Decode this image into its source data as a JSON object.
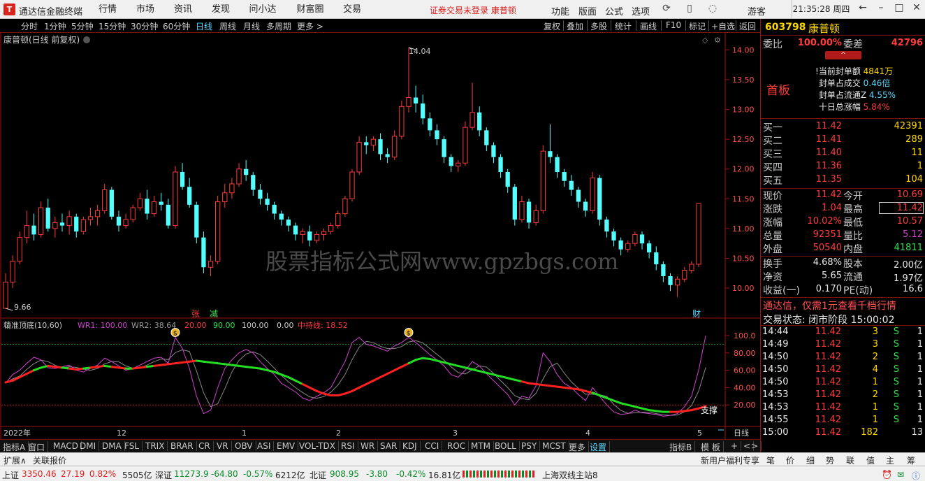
{
  "titlebar": {
    "app_name": "通达信金融终端",
    "menus": [
      "行情",
      "市场",
      "资讯",
      "发现",
      "问小达",
      "财富圈",
      "交易"
    ],
    "warning": "证券交易未登录  康普顿",
    "right_menus": [
      "功能",
      "版面",
      "公式",
      "选项"
    ],
    "guest": "游客",
    "clock": "21:35:28 周四"
  },
  "periodbar": {
    "periods": [
      "分时",
      "1分钟",
      "5分钟",
      "15分钟",
      "30分钟",
      "60分钟",
      "日线",
      "周线",
      "月线",
      "多周期",
      "更多 >"
    ],
    "tools": [
      "复权",
      "叠加",
      "多股",
      "统计",
      "画线",
      "F10",
      "标记",
      "+自选",
      "返回"
    ]
  },
  "chart": {
    "label": "康普顿(日线 前复权)",
    "watermark": "股票指标公式网www.gpzbgs.com",
    "high_marker": "14.04",
    "low_marker": "9.66",
    "price_ticks": [
      "14.00",
      "13.50",
      "13.00",
      "12.50",
      "12.00",
      "11.50",
      "11.00",
      "10.50",
      "10.00"
    ],
    "event_zhang": "张",
    "event_jian": "减",
    "event_cai": "财",
    "indicator": {
      "name": "精准顶底(10,60)",
      "wr1_label": "WR1: 100.00",
      "wr2_label": "WR2: 38.64",
      "v20": "20.00",
      "v90": "90.00",
      "v100": "100.00",
      "v0": "0.00",
      "mid_label": "中持线: 18.52",
      "ticks": [
        "100.0",
        "80.00",
        "60.00",
        "40.00",
        "20.00"
      ],
      "support_label": "支撑"
    },
    "xaxis": [
      "2022年",
      "12",
      "1",
      "2",
      "3",
      "4",
      "5"
    ],
    "right_label": "日线"
  },
  "chart_data": {
    "type": "candlestick",
    "ylim": [
      9.66,
      14.04
    ],
    "candles": [
      [
        9.66,
        10.25,
        9.66,
        10.1
      ],
      [
        10.1,
        10.55,
        10.0,
        10.45
      ],
      [
        10.45,
        10.95,
        10.4,
        10.85
      ],
      [
        10.85,
        11.3,
        10.75,
        11.05
      ],
      [
        11.05,
        11.25,
        10.8,
        10.9
      ],
      [
        10.9,
        11.45,
        10.85,
        11.35
      ],
      [
        11.35,
        11.5,
        10.95,
        11.0
      ],
      [
        11.0,
        11.2,
        10.85,
        11.1
      ],
      [
        11.1,
        11.25,
        10.95,
        11.05
      ],
      [
        11.05,
        11.3,
        10.9,
        11.2
      ],
      [
        11.2,
        11.25,
        10.85,
        10.95
      ],
      [
        10.95,
        11.2,
        10.9,
        11.15
      ],
      [
        11.15,
        11.35,
        11.05,
        11.2
      ],
      [
        11.2,
        11.4,
        11.05,
        11.3
      ],
      [
        11.3,
        11.75,
        11.25,
        11.65
      ],
      [
        11.65,
        11.7,
        11.15,
        11.2
      ],
      [
        11.2,
        11.3,
        10.95,
        11.05
      ],
      [
        11.05,
        11.25,
        11.0,
        11.15
      ],
      [
        11.15,
        11.4,
        11.1,
        11.35
      ],
      [
        11.35,
        11.6,
        11.3,
        11.5
      ],
      [
        11.5,
        11.65,
        11.15,
        11.25
      ],
      [
        11.25,
        11.55,
        11.2,
        11.45
      ],
      [
        11.45,
        11.6,
        11.3,
        11.4
      ],
      [
        11.4,
        11.5,
        11.0,
        11.05
      ],
      [
        11.05,
        12.05,
        11.0,
        11.95
      ],
      [
        11.95,
        12.1,
        11.65,
        11.7
      ],
      [
        11.7,
        11.85,
        11.35,
        11.4
      ],
      [
        11.4,
        11.45,
        10.75,
        10.85
      ],
      [
        10.85,
        10.95,
        10.25,
        10.35
      ],
      [
        10.35,
        10.55,
        10.2,
        10.45
      ],
      [
        10.45,
        11.55,
        10.4,
        11.45
      ],
      [
        11.45,
        11.75,
        11.35,
        11.6
      ],
      [
        11.6,
        11.85,
        11.5,
        11.75
      ],
      [
        11.75,
        12.1,
        11.7,
        12.0
      ],
      [
        12.0,
        12.15,
        11.8,
        11.9
      ],
      [
        11.9,
        11.95,
        11.55,
        11.65
      ],
      [
        11.65,
        11.75,
        11.4,
        11.5
      ],
      [
        11.5,
        11.6,
        11.3,
        11.4
      ],
      [
        11.4,
        11.45,
        11.15,
        11.25
      ],
      [
        11.25,
        11.3,
        11.05,
        11.15
      ],
      [
        11.15,
        11.2,
        10.95,
        11.05
      ],
      [
        11.05,
        11.1,
        10.8,
        10.9
      ],
      [
        10.9,
        11.0,
        10.75,
        10.95
      ],
      [
        10.95,
        11.05,
        10.7,
        10.8
      ],
      [
        10.8,
        10.95,
        10.75,
        10.9
      ],
      [
        10.9,
        11.0,
        10.8,
        10.95
      ],
      [
        10.95,
        11.1,
        10.9,
        11.05
      ],
      [
        11.05,
        11.3,
        11.0,
        11.25
      ],
      [
        11.25,
        11.55,
        11.2,
        11.5
      ],
      [
        11.5,
        12.0,
        11.45,
        11.95
      ],
      [
        11.95,
        12.55,
        11.9,
        12.45
      ],
      [
        12.45,
        12.55,
        12.25,
        12.4
      ],
      [
        12.4,
        12.55,
        12.3,
        12.5
      ],
      [
        12.5,
        12.6,
        12.15,
        12.25
      ],
      [
        12.25,
        12.35,
        12.1,
        12.2
      ],
      [
        12.2,
        12.65,
        12.15,
        12.55
      ],
      [
        12.55,
        13.15,
        12.5,
        13.05
      ],
      [
        13.05,
        14.04,
        12.95,
        13.2
      ],
      [
        13.2,
        13.4,
        12.95,
        13.1
      ],
      [
        13.1,
        13.25,
        12.75,
        12.85
      ],
      [
        12.85,
        12.95,
        12.55,
        12.65
      ],
      [
        12.65,
        12.75,
        12.4,
        12.5
      ],
      [
        12.5,
        12.55,
        12.1,
        12.2
      ],
      [
        12.2,
        12.25,
        11.95,
        12.05
      ],
      [
        12.05,
        12.15,
        11.95,
        12.1
      ],
      [
        12.1,
        12.8,
        12.05,
        12.7
      ],
      [
        12.7,
        13.45,
        12.65,
        12.95
      ],
      [
        12.95,
        13.05,
        12.55,
        12.65
      ],
      [
        12.65,
        12.7,
        12.3,
        12.4
      ],
      [
        12.4,
        12.45,
        12.1,
        12.2
      ],
      [
        12.2,
        12.25,
        11.85,
        11.95
      ],
      [
        11.95,
        12.0,
        11.6,
        11.7
      ],
      [
        11.7,
        11.75,
        11.05,
        11.15
      ],
      [
        11.15,
        11.55,
        11.1,
        11.45
      ],
      [
        11.45,
        11.5,
        11.0,
        11.1
      ],
      [
        11.1,
        11.4,
        11.05,
        11.3
      ],
      [
        11.3,
        12.4,
        11.25,
        12.3
      ],
      [
        12.3,
        12.75,
        12.1,
        12.2
      ],
      [
        12.2,
        12.25,
        11.85,
        11.95
      ],
      [
        11.95,
        12.0,
        11.7,
        11.8
      ],
      [
        11.8,
        11.9,
        11.55,
        11.65
      ],
      [
        11.65,
        11.7,
        11.35,
        11.45
      ],
      [
        11.45,
        11.5,
        11.2,
        11.3
      ],
      [
        11.3,
        11.95,
        11.25,
        11.85
      ],
      [
        11.85,
        11.9,
        11.05,
        11.15
      ],
      [
        11.15,
        11.2,
        10.85,
        10.95
      ],
      [
        10.95,
        11.0,
        10.7,
        10.8
      ],
      [
        10.8,
        10.85,
        10.55,
        10.65
      ],
      [
        10.65,
        10.8,
        10.6,
        10.75
      ],
      [
        10.75,
        10.95,
        10.7,
        10.9
      ],
      [
        10.9,
        10.95,
        10.65,
        10.75
      ],
      [
        10.75,
        10.8,
        10.5,
        10.6
      ],
      [
        10.6,
        10.7,
        10.3,
        10.4
      ],
      [
        10.4,
        10.45,
        10.1,
        10.2
      ],
      [
        10.2,
        10.25,
        9.95,
        10.05
      ],
      [
        10.05,
        10.2,
        9.85,
        10.15
      ],
      [
        10.15,
        10.35,
        10.1,
        10.3
      ],
      [
        10.3,
        10.45,
        10.25,
        10.4
      ],
      [
        10.4,
        11.42,
        10.35,
        11.42
      ]
    ],
    "wr": [
      45,
      55,
      60,
      68,
      75,
      72,
      63,
      62,
      64,
      66,
      60,
      58,
      62,
      66,
      74,
      70,
      65,
      60,
      62,
      66,
      70,
      74,
      75,
      68,
      98,
      85,
      62,
      30,
      10,
      14,
      40,
      62,
      72,
      80,
      84,
      80,
      70,
      62,
      55,
      45,
      40,
      35,
      28,
      25,
      30,
      34,
      40,
      55,
      70,
      92,
      98,
      90,
      88,
      85,
      82,
      88,
      92,
      98,
      92,
      85,
      78,
      72,
      65,
      55,
      52,
      60,
      70,
      65,
      56,
      48,
      40,
      32,
      20,
      30,
      28,
      42,
      80,
      70,
      55,
      45,
      40,
      32,
      25,
      40,
      30,
      20,
      12,
      9,
      10,
      14,
      11,
      10,
      9,
      7,
      8,
      10,
      18,
      30,
      60,
      100
    ],
    "mid": [
      46,
      48,
      52,
      56,
      60,
      63,
      65,
      64,
      63,
      62,
      61,
      62,
      63,
      64,
      65,
      64,
      63,
      62,
      62,
      63,
      64,
      65,
      66,
      67,
      68,
      69,
      70,
      71,
      70,
      69,
      68,
      67,
      66,
      65,
      64,
      63,
      62,
      60,
      58,
      55,
      52,
      48,
      44,
      40,
      36,
      33,
      31,
      31,
      33,
      36,
      40,
      44,
      48,
      52,
      56,
      60,
      64,
      68,
      72,
      74,
      73,
      71,
      69,
      67,
      65,
      63,
      61,
      59,
      57,
      55,
      53,
      51,
      49,
      47,
      45,
      44,
      43,
      42,
      41,
      40,
      39,
      38,
      36,
      34,
      31,
      28,
      25,
      22,
      20,
      18,
      16,
      14,
      13,
      12,
      12,
      12,
      13,
      14,
      16,
      18.52
    ],
    "mid_red": [
      1,
      1,
      1,
      1,
      1,
      0,
      0,
      1,
      1,
      0,
      1,
      1,
      0,
      1,
      1,
      0,
      1,
      1,
      0,
      1,
      1,
      0,
      1,
      1,
      1,
      1,
      1,
      1,
      0,
      0,
      0,
      0,
      0,
      0,
      0,
      0,
      0,
      0,
      0,
      0,
      0,
      0,
      0,
      1,
      1,
      1,
      1,
      1,
      1,
      1,
      1,
      1,
      1,
      1,
      1,
      1,
      1,
      1,
      0,
      0,
      0,
      0,
      0,
      0,
      0,
      0,
      0,
      0,
      0,
      0,
      0,
      0,
      0,
      0,
      1,
      1,
      1,
      1,
      1,
      1,
      1,
      1,
      1,
      1,
      0,
      0,
      0,
      0,
      0,
      0,
      0,
      0,
      0,
      0,
      0,
      1,
      1,
      1,
      1,
      1
    ]
  },
  "quote": {
    "code": "603798",
    "name": "康普顿",
    "weibi_label": "委比",
    "weibi_value": "100.00%",
    "weicha_label": "委差",
    "weicha_value": "42796",
    "board_label": "首板",
    "seal_rows": [
      {
        "label": "当前封单额",
        "value": "4841万"
      },
      {
        "label": "封单占成交",
        "value": "0.46倍"
      },
      {
        "label": "封单占流通Z",
        "value": "4.55%"
      },
      {
        "label": "十日总涨幅",
        "value": "5.84%"
      }
    ],
    "bids": [
      {
        "label": "买一",
        "price": "11.42",
        "vol": "42391"
      },
      {
        "label": "买二",
        "price": "11.41",
        "vol": "289"
      },
      {
        "label": "买三",
        "price": "11.40",
        "vol": "11"
      },
      {
        "label": "买四",
        "price": "11.36",
        "vol": "1"
      },
      {
        "label": "买五",
        "price": "11.35",
        "vol": "104"
      }
    ],
    "stats": [
      {
        "l1": "现价",
        "v1": "11.42",
        "l2": "今开",
        "v2": "10.69"
      },
      {
        "l1": "涨跌",
        "v1": "1.04",
        "l2": "最高",
        "v2": "11.42"
      },
      {
        "l1": "涨幅",
        "v1": "10.02%",
        "l2": "最低",
        "v2": "10.57"
      },
      {
        "l1": "总量",
        "v1": "92351",
        "l2": "量比",
        "v2": "5.12"
      },
      {
        "l1": "外盘",
        "v1": "50540",
        "l2": "内盘",
        "v2": "41811"
      }
    ],
    "stats2": [
      {
        "l1": "换手",
        "v1": "4.68%",
        "l2": "股本",
        "v2": "2.00亿"
      },
      {
        "l1": "净资",
        "v1": "5.65",
        "l2": "流通",
        "v2": "1.97亿"
      },
      {
        "l1": "收益(一)",
        "v1": "0.170",
        "l2": "PE(动)",
        "v2": "16.6"
      }
    ],
    "ad": "通达信，仅需1元查看千档行情",
    "trade_status": "交易状态: 闭市阶段 15:00:02",
    "ticks": [
      {
        "t": "14:44",
        "p": "11.42",
        "v": "3",
        "s": "S",
        "n": "1"
      },
      {
        "t": "14:49",
        "p": "11.42",
        "v": "3",
        "s": "S",
        "n": "1"
      },
      {
        "t": "14:50",
        "p": "11.42",
        "v": "2",
        "s": "S",
        "n": "1"
      },
      {
        "t": "14:50",
        "p": "11.42",
        "v": "4",
        "s": "S",
        "n": "1"
      },
      {
        "t": "14:50",
        "p": "11.42",
        "v": "1",
        "s": "S",
        "n": "1"
      },
      {
        "t": "14:53",
        "p": "11.42",
        "v": "2",
        "s": "S",
        "n": "1"
      },
      {
        "t": "14:53",
        "p": "11.42",
        "v": "1",
        "s": "S",
        "n": "1"
      },
      {
        "t": "14:55",
        "p": "11.42",
        "v": "1",
        "s": "S",
        "n": "1"
      },
      {
        "t": "15:00",
        "p": "11.42",
        "v": "182",
        "s": "",
        "n": "13"
      }
    ]
  },
  "indtabs": [
    "指标A",
    "窗口",
    "MACD",
    "DMI",
    "DMA",
    "FSL",
    "TRIX",
    "BRAR",
    "CR",
    "VR",
    "OBV",
    "ASI",
    "EMV",
    "VOL-TDX",
    "RSI",
    "WR",
    "SAR",
    "KDJ",
    "CCI",
    "ROC",
    "MTM",
    "BOLL",
    "PSY",
    "MCST",
    "更多",
    "设置"
  ],
  "indtabs_right": [
    "指标B",
    "模 板",
    "+",
    "<",
    ">"
  ],
  "status": {
    "left": [
      "扩展∧",
      "关联报价"
    ],
    "right": [
      "新用户福利专享",
      "笔",
      "价",
      "细",
      "势",
      "联",
      "值",
      "主",
      "筹"
    ]
  },
  "ticker": {
    "sh_label": "上证",
    "sh_val": "3350.46",
    "sh_chg": "27.19",
    "sh_pct": "0.82%",
    "sh_amt": "5505亿",
    "sz_label": "深证",
    "sz_val": "11273.9",
    "sz_chg": "-64.80",
    "sz_pct": "-0.57%",
    "sz_amt": "6212亿",
    "bz_label": "北证",
    "bz_val": "908.95",
    "bz_chg": "-3.80",
    "bz_pct": "-0.42%",
    "bz_amt": "16.81亿",
    "station": "上海双线主站8"
  },
  "colors": {
    "up": "#ff3b3b",
    "down": "#54ffff",
    "mid_up": "#ff2020",
    "mid_down": "#22dd22",
    "wr1": "#d040d0",
    "wr2": "#888888",
    "frame": "#a01010"
  }
}
